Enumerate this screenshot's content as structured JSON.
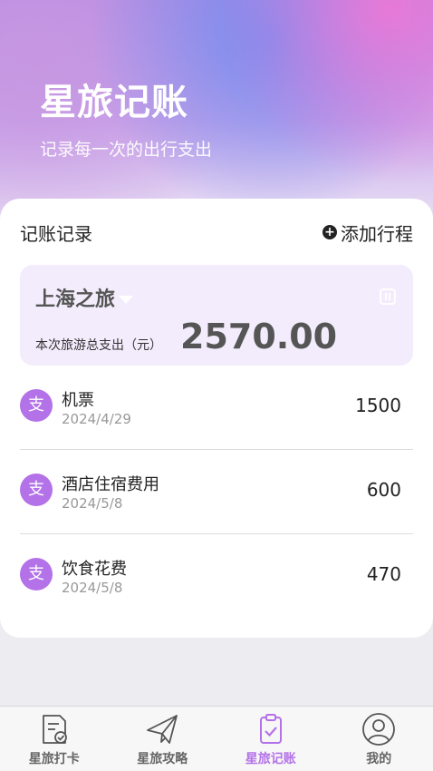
{
  "header": {
    "title": "星旅记账",
    "subtitle": "记录每一次的出行支出"
  },
  "records": {
    "section_title": "记账记录",
    "add_trip_label": "添加行程"
  },
  "trip": {
    "name": "上海之旅",
    "total_label": "本次旅游总支出（元）",
    "total_amount": "2570.00"
  },
  "expenses": [
    {
      "badge": "支",
      "name": "机票",
      "date": "2024/4/29",
      "amount": "1500"
    },
    {
      "badge": "支",
      "name": "酒店住宿费用",
      "date": "2024/5/8",
      "amount": "600"
    },
    {
      "badge": "支",
      "name": "饮食花费",
      "date": "2024/5/8",
      "amount": "470"
    }
  ],
  "tabbar": {
    "items": [
      {
        "label": "星旅打卡",
        "icon": "checkin-doc-icon"
      },
      {
        "label": "星旅攻略",
        "icon": "paper-plane-icon"
      },
      {
        "label": "星旅记账",
        "icon": "ledger-check-icon"
      },
      {
        "label": "我的",
        "icon": "user-profile-icon"
      }
    ],
    "active_index": 2
  },
  "colors": {
    "accent": "#b372e8",
    "trip_card_bg": "#f3ecfc",
    "page_bg": "#ececf1"
  }
}
